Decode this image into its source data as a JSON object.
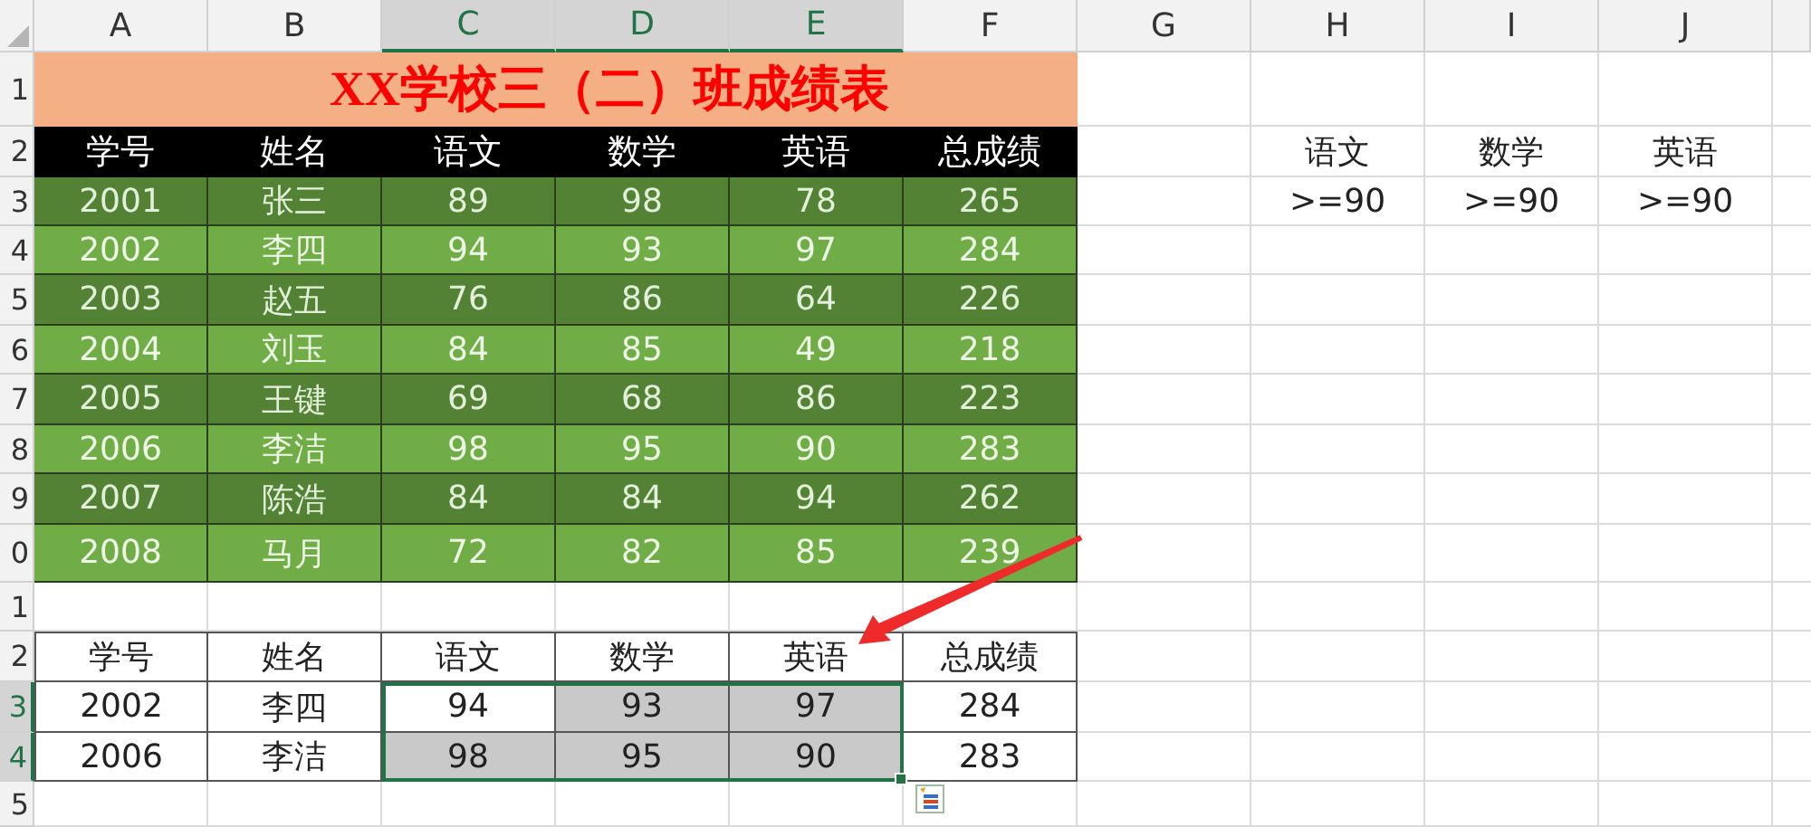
{
  "columns": [
    {
      "label": "A",
      "selected": false
    },
    {
      "label": "B",
      "selected": false
    },
    {
      "label": "C",
      "selected": true
    },
    {
      "label": "D",
      "selected": true
    },
    {
      "label": "E",
      "selected": true
    },
    {
      "label": "F",
      "selected": false
    },
    {
      "label": "G",
      "selected": false
    },
    {
      "label": "H",
      "selected": false
    },
    {
      "label": "I",
      "selected": false
    },
    {
      "label": "J",
      "selected": false
    }
  ],
  "rows": [
    {
      "number": "1",
      "selected": false,
      "kind": "title",
      "cells": [
        {
          "text": "XX学校三（二）班成绩表"
        }
      ]
    },
    {
      "number": "2",
      "selected": false,
      "kind": "header",
      "cells": [
        {
          "text": "学号"
        },
        {
          "text": "姓名"
        },
        {
          "text": "语文"
        },
        {
          "text": "数学"
        },
        {
          "text": "英语"
        },
        {
          "text": "总成绩"
        }
      ],
      "criteria": [
        "语文",
        "数学",
        "英语"
      ]
    },
    {
      "number": "3",
      "selected": false,
      "kind": "dark",
      "cells": [
        {
          "text": "2001"
        },
        {
          "text": "张三"
        },
        {
          "text": "89"
        },
        {
          "text": "98"
        },
        {
          "text": "78"
        },
        {
          "text": "265"
        }
      ],
      "criteria": [
        ">=90",
        ">=90",
        ">=90"
      ]
    },
    {
      "number": "4",
      "selected": false,
      "kind": "light",
      "cells": [
        {
          "text": "2002"
        },
        {
          "text": "李四"
        },
        {
          "text": "94"
        },
        {
          "text": "93"
        },
        {
          "text": "97"
        },
        {
          "text": "284"
        }
      ]
    },
    {
      "number": "5",
      "selected": false,
      "kind": "dark",
      "cells": [
        {
          "text": "2003"
        },
        {
          "text": "赵五"
        },
        {
          "text": "76"
        },
        {
          "text": "86"
        },
        {
          "text": "64"
        },
        {
          "text": "226"
        }
      ]
    },
    {
      "number": "6",
      "selected": false,
      "kind": "light",
      "cells": [
        {
          "text": "2004"
        },
        {
          "text": "刘玉"
        },
        {
          "text": "84"
        },
        {
          "text": "85"
        },
        {
          "text": "49"
        },
        {
          "text": "218"
        }
      ]
    },
    {
      "number": "7",
      "selected": false,
      "kind": "dark",
      "cells": [
        {
          "text": "2005"
        },
        {
          "text": "王键"
        },
        {
          "text": "69"
        },
        {
          "text": "68"
        },
        {
          "text": "86"
        },
        {
          "text": "223"
        }
      ]
    },
    {
      "number": "8",
      "selected": false,
      "kind": "light",
      "cells": [
        {
          "text": "2006"
        },
        {
          "text": "李洁"
        },
        {
          "text": "98"
        },
        {
          "text": "95"
        },
        {
          "text": "90"
        },
        {
          "text": "283"
        }
      ]
    },
    {
      "number": "9",
      "selected": false,
      "kind": "dark",
      "cells": [
        {
          "text": "2007"
        },
        {
          "text": "陈浩"
        },
        {
          "text": "84"
        },
        {
          "text": "84"
        },
        {
          "text": "94"
        },
        {
          "text": "262"
        }
      ]
    },
    {
      "number": "0",
      "selected": false,
      "kind": "light",
      "cells": [
        {
          "text": "2008"
        },
        {
          "text": "马月"
        },
        {
          "text": "72"
        },
        {
          "text": "82"
        },
        {
          "text": "85"
        },
        {
          "text": "239"
        }
      ]
    },
    {
      "number": "1",
      "selected": false,
      "kind": "empty"
    },
    {
      "number": "2",
      "selected": false,
      "kind": "plain",
      "cells": [
        {
          "text": "学号"
        },
        {
          "text": "姓名"
        },
        {
          "text": "语文"
        },
        {
          "text": "数学"
        },
        {
          "text": "英语"
        },
        {
          "text": "总成绩"
        }
      ]
    },
    {
      "number": "3",
      "selected": true,
      "kind": "plain",
      "cells": [
        {
          "text": "2002",
          "highlighted": false
        },
        {
          "text": "李四",
          "highlighted": false
        },
        {
          "text": "94",
          "highlighted": false
        },
        {
          "text": "93",
          "highlighted": true
        },
        {
          "text": "97",
          "highlighted": true
        },
        {
          "text": "284",
          "highlighted": false
        }
      ]
    },
    {
      "number": "4",
      "selected": true,
      "kind": "plain",
      "cells": [
        {
          "text": "2006",
          "highlighted": false
        },
        {
          "text": "李洁",
          "highlighted": false
        },
        {
          "text": "98",
          "highlighted": true
        },
        {
          "text": "95",
          "highlighted": true
        },
        {
          "text": "90",
          "highlighted": true
        },
        {
          "text": "283",
          "highlighted": false
        }
      ]
    },
    {
      "number": "5",
      "selected": false,
      "kind": "empty"
    }
  ]
}
